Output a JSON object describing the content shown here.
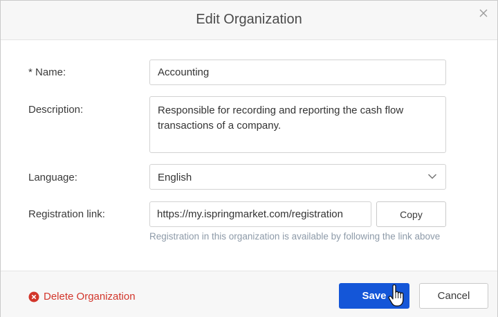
{
  "dialog": {
    "title": "Edit Organization"
  },
  "form": {
    "name_label": "* Name:",
    "name_value": "Accounting",
    "description_label": "Description:",
    "description_value": "Responsible for recording and reporting the cash flow transactions of a company.",
    "language_label": "Language:",
    "language_value": "English",
    "registration_label": "Registration link:",
    "registration_value": "https://my.ispringmarket.com/registration",
    "copy_label": "Copy",
    "registration_hint": "Registration in this organization is available by following the link above"
  },
  "footer": {
    "delete_label": "Delete Organization",
    "save_label": "Save",
    "cancel_label": "Cancel"
  },
  "colors": {
    "primary": "#1456d8",
    "danger": "#d2352a",
    "hint": "#8d9aa8"
  },
  "icons": {
    "close": "close-icon",
    "chevron": "chevron-down-icon",
    "delete": "delete-circle-icon",
    "cursor": "hand-pointer-icon"
  }
}
